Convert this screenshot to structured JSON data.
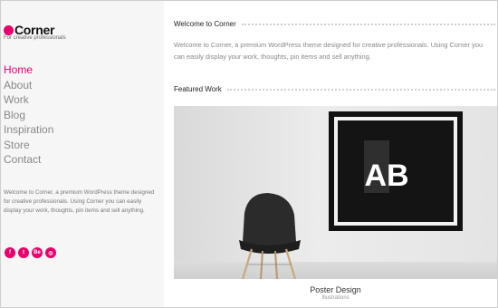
{
  "brand": {
    "name": "Corner",
    "tagline": "For creative professionals",
    "accent": "#e8006d"
  },
  "nav": {
    "items": [
      {
        "label": "Home",
        "active": true
      },
      {
        "label": "About",
        "active": false
      },
      {
        "label": "Work",
        "active": false
      },
      {
        "label": "Blog",
        "active": false
      },
      {
        "label": "Inspiration",
        "active": false
      },
      {
        "label": "Store",
        "active": false
      },
      {
        "label": "Contact",
        "active": false
      }
    ]
  },
  "sidebar": {
    "about": "Welcome to Corner, a premium WordPress theme designed for creative professionals. Using Corner you can easily display your work, thoughts, pin items and sell anything.",
    "socials": [
      {
        "icon": "facebook-icon",
        "glyph": "f"
      },
      {
        "icon": "twitter-icon",
        "glyph": "t"
      },
      {
        "icon": "behance-icon",
        "glyph": "Be"
      },
      {
        "icon": "dribbble-icon",
        "glyph": "◎"
      }
    ]
  },
  "welcome": {
    "heading": "Welcome to Corner",
    "text": "Welcome to Corner, a premium WordPress theme designed for creative professionals. Using Corner you can easily display your work, thoughts, pin items and sell anything."
  },
  "featured": {
    "heading": "Featured Work",
    "item_title": "Poster Design",
    "item_category": "Illustrations",
    "poster_text": "AB"
  }
}
